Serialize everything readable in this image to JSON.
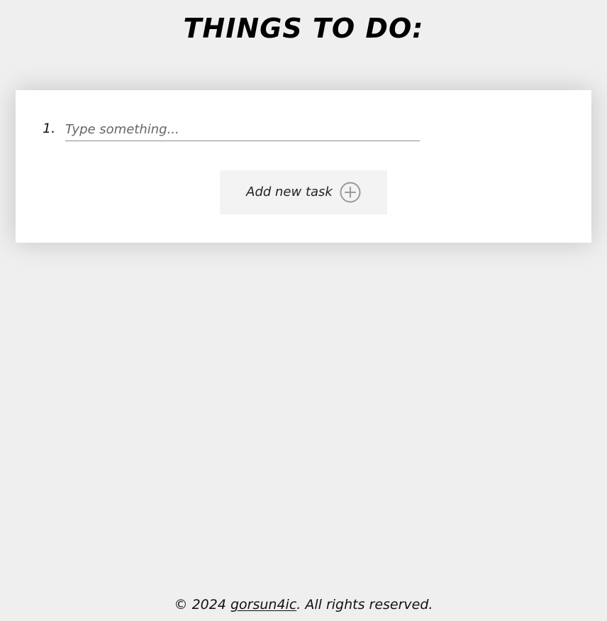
{
  "header": {
    "title": "THINGS TO DO:"
  },
  "task_list": {
    "items": [
      {
        "number": "1.",
        "value": "",
        "placeholder": "Type something..."
      }
    ]
  },
  "actions": {
    "add_task_label": "Add new task",
    "add_task_icon": "plus-circle-icon"
  },
  "footer": {
    "prefix": "© 2024 ",
    "link_text": "gorsun4ic",
    "suffix": ". All rights reserved."
  },
  "colors": {
    "background": "#efefef",
    "card": "#ffffff",
    "button_background": "#f3f3f3",
    "input_underline": "#8b8b8b",
    "icon": "#9a9a9a"
  }
}
